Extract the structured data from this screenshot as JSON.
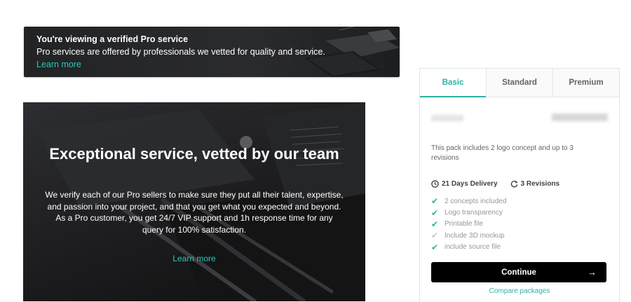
{
  "banner": {
    "title": "You're viewing a verified Pro service",
    "text": "Pro services are offered by professionals we vetted for quality and service.",
    "link": "Learn more"
  },
  "hero": {
    "title": "Exceptional service, vetted by our team",
    "paragraph1": "We verify each of our Pro sellers to make sure they put all their talent, expertise, and passion into your project, and that you get what you expected and beyond.",
    "paragraph2": "As a Pro customer, you get 24/7 VIP support and 1h response time for any query for 100% satisfaction.",
    "link": "Learn more"
  },
  "package": {
    "tabs": [
      {
        "label": "Basic",
        "active": true
      },
      {
        "label": "Standard",
        "active": false
      },
      {
        "label": "Premium",
        "active": false
      }
    ],
    "description": "This pack includes 2 logo concept and up to 3 revisions",
    "delivery": "21 Days Delivery",
    "revisions": "3 Revisions",
    "features": [
      {
        "label": "2 concepts included",
        "included": true
      },
      {
        "label": "Logo transparency",
        "included": true
      },
      {
        "label": "Printable file",
        "included": true
      },
      {
        "label": "Include 3D mockup",
        "included": false
      },
      {
        "label": "include source file",
        "included": true
      }
    ],
    "continue_label": "Continue",
    "compare_label": "Compare packages"
  },
  "colors": {
    "accent": "#2ab3a3",
    "banner_bg": "#222325",
    "button_bg": "#000000"
  },
  "icons": {
    "clock": "clock-icon",
    "revisions": "refresh-icon",
    "check": "check-icon",
    "arrow": "arrow-right-icon"
  }
}
